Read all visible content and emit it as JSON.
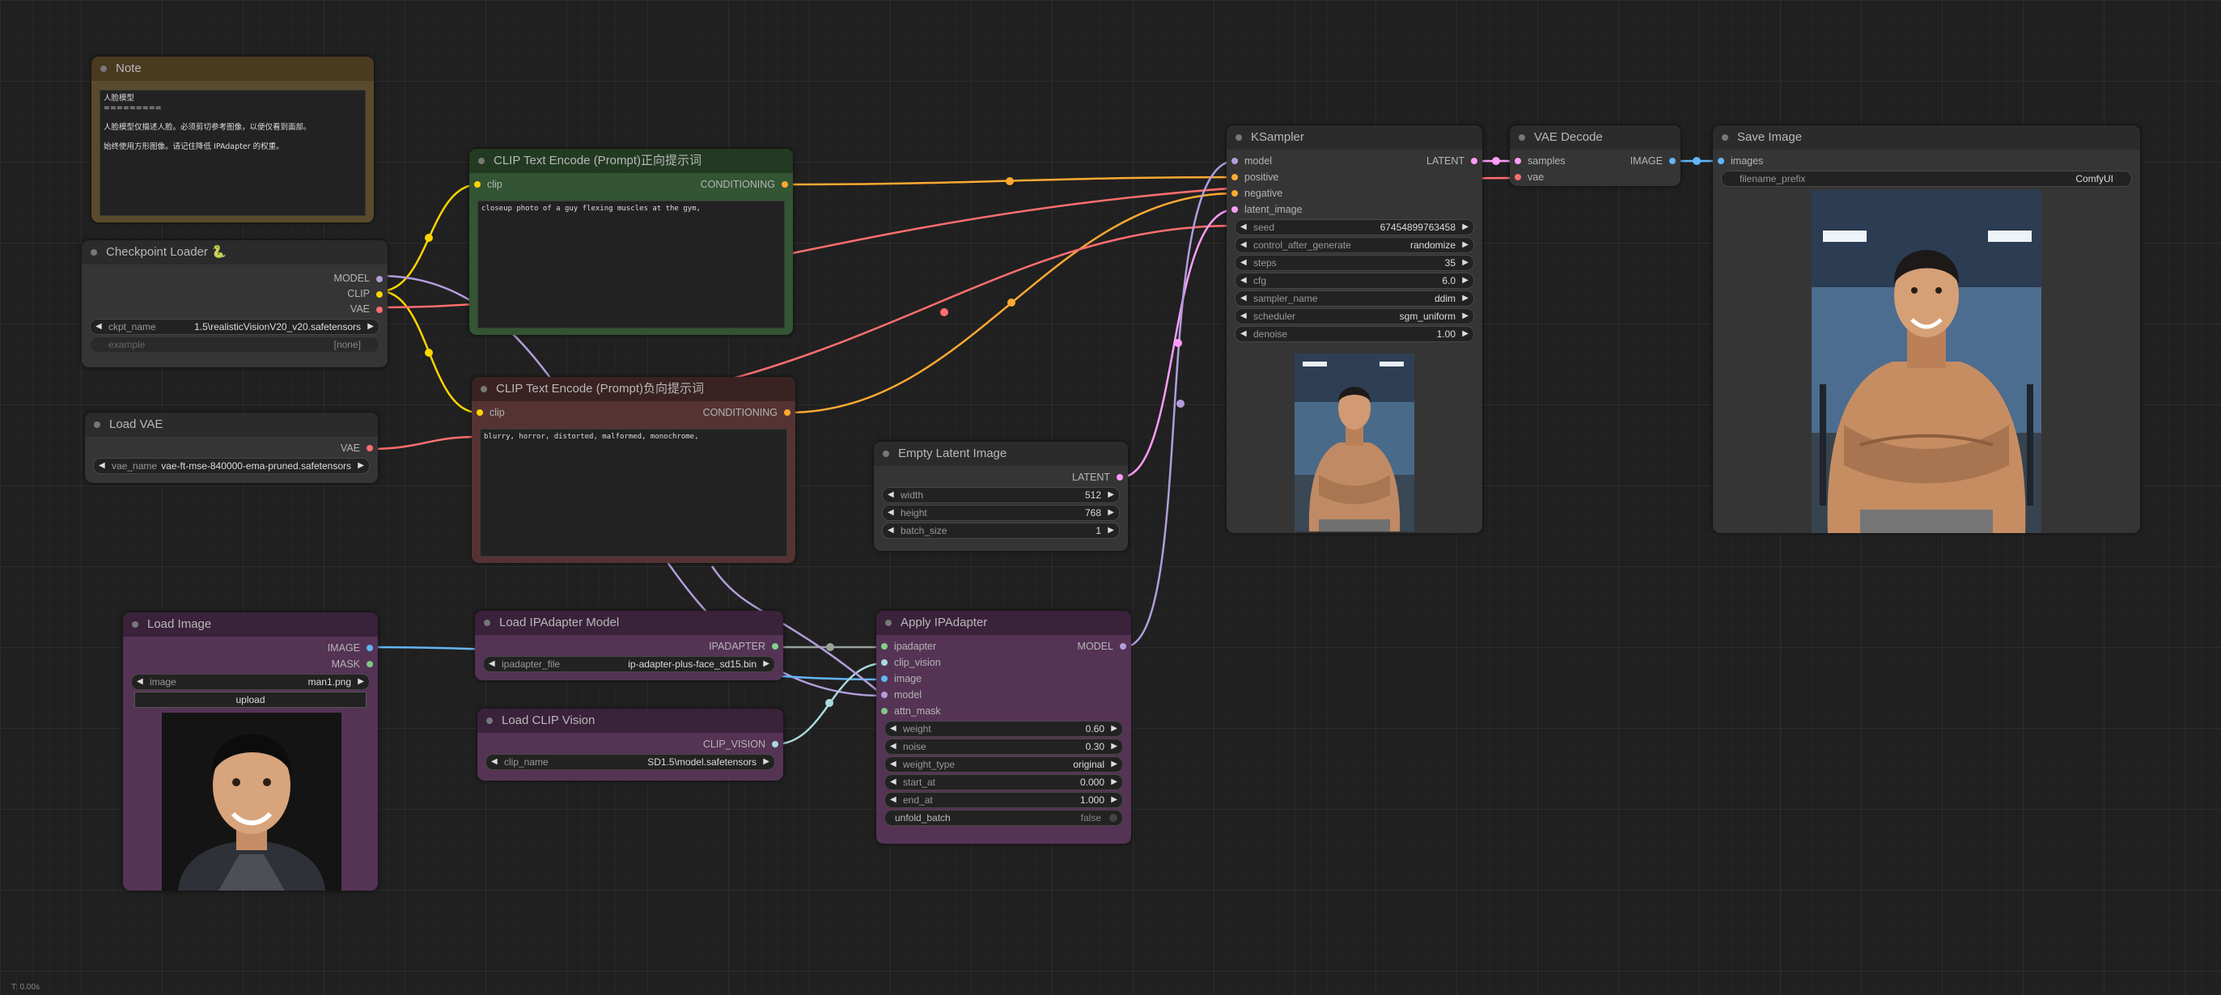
{
  "status": "T: 0.00s",
  "colors": {
    "clip": "#ffd500",
    "conditioning": "#ffa931",
    "model": "#b39ddb",
    "vae": "#ff6e6e",
    "latent": "#ff9cf9",
    "image": "#64b5f6",
    "mask": "#81c784",
    "ipadapter": "#7fd287",
    "clip_vision": "#a8dadc"
  },
  "note": {
    "title": "Note",
    "text": "人脸模型\n=========\n\n人脸模型仅描述人脸。必须剪切参考图像，以便仅看到面部。\n\n始终使用方形图像。请记住降低 IPAdapter 的权重。"
  },
  "checkpoint": {
    "title": "Checkpoint Loader 🐍",
    "outputs": [
      "MODEL",
      "CLIP",
      "VAE"
    ],
    "ckpt_label": "ckpt_name",
    "ckpt_value": "1.5\\realisticVisionV20_v20.safetensors",
    "example_label": "example",
    "example_value": "[none]"
  },
  "load_vae": {
    "title": "Load VAE",
    "output": "VAE",
    "label": "vae_name",
    "value": "vae-ft-mse-840000-ema-pruned.safetensors"
  },
  "clip_pos": {
    "title": "CLIP Text Encode (Prompt)正向提示词",
    "input": "clip",
    "output": "CONDITIONING",
    "text": "closeup photo of a guy flexing muscles at the gym,"
  },
  "clip_neg": {
    "title": "CLIP Text Encode (Prompt)负向提示词",
    "input": "clip",
    "output": "CONDITIONING",
    "text": "blurry, horror, distorted, malformed, monochrome,"
  },
  "empty_latent": {
    "title": "Empty Latent Image",
    "output": "LATENT",
    "widgets": [
      {
        "label": "width",
        "value": "512"
      },
      {
        "label": "height",
        "value": "768"
      },
      {
        "label": "batch_size",
        "value": "1"
      }
    ]
  },
  "ksampler": {
    "title": "KSampler",
    "inputs": [
      "model",
      "positive",
      "negative",
      "latent_image"
    ],
    "output": "LATENT",
    "widgets": [
      {
        "label": "seed",
        "value": "67454899763458"
      },
      {
        "label": "control_after_generate",
        "value": "randomize"
      },
      {
        "label": "steps",
        "value": "35"
      },
      {
        "label": "cfg",
        "value": "6.0"
      },
      {
        "label": "sampler_name",
        "value": "ddim"
      },
      {
        "label": "scheduler",
        "value": "sgm_uniform"
      },
      {
        "label": "denoise",
        "value": "1.00"
      }
    ]
  },
  "vae_decode": {
    "title": "VAE Decode",
    "inputs": [
      "samples",
      "vae"
    ],
    "output": "IMAGE"
  },
  "save_image": {
    "title": "Save Image",
    "input": "images",
    "prefix_label": "filename_prefix",
    "prefix_value": "ComfyUI"
  },
  "load_image": {
    "title": "Load Image",
    "outputs": [
      "IMAGE",
      "MASK"
    ],
    "image_label": "image",
    "image_value": "man1.png",
    "upload": "upload"
  },
  "ipadapter_model": {
    "title": "Load IPAdapter Model",
    "output": "IPADAPTER",
    "label": "ipadapter_file",
    "value": "ip-adapter-plus-face_sd15.bin"
  },
  "clip_vision": {
    "title": "Load CLIP Vision",
    "output": "CLIP_VISION",
    "label": "clip_name",
    "value": "SD1.5\\model.safetensors"
  },
  "apply_ipadapter": {
    "title": "Apply IPAdapter",
    "inputs": [
      "ipadapter",
      "clip_vision",
      "image",
      "model",
      "attn_mask"
    ],
    "output": "MODEL",
    "widgets": [
      {
        "label": "weight",
        "value": "0.60"
      },
      {
        "label": "noise",
        "value": "0.30"
      },
      {
        "label": "weight_type",
        "value": "original"
      },
      {
        "label": "start_at",
        "value": "0.000"
      },
      {
        "label": "end_at",
        "value": "1.000"
      }
    ],
    "unfold_label": "unfold_batch",
    "unfold_value": "false"
  }
}
